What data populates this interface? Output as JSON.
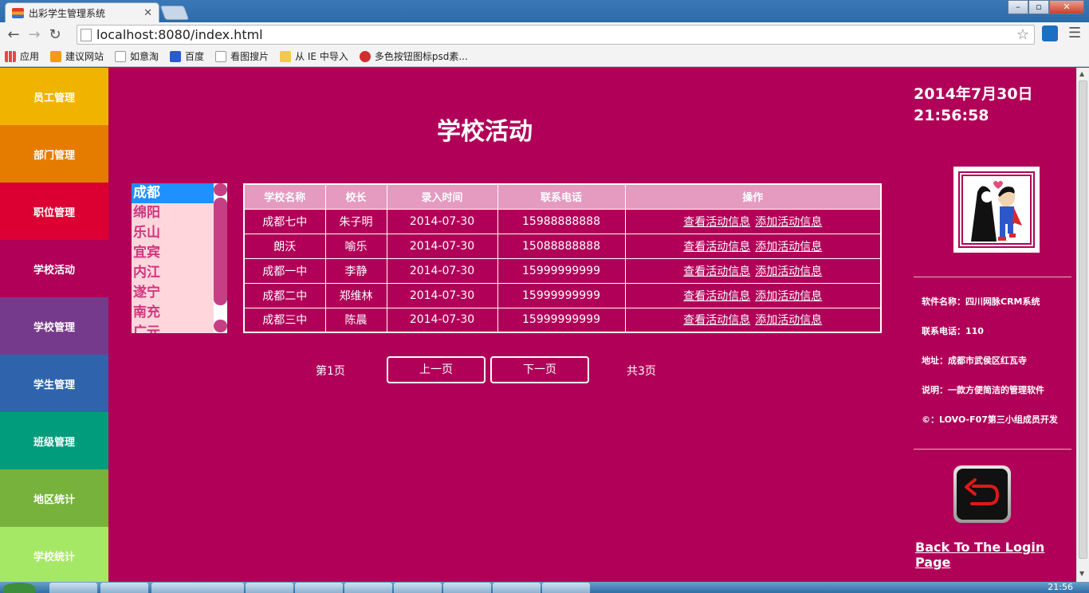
{
  "browser": {
    "tab_title": "出彩学生管理系统",
    "url": "localhost:8080/index.html",
    "bookmarks": [
      "应用",
      "建议网站",
      "如意淘",
      "百度",
      "看图搜片",
      "从 IE 中导入",
      "多色按钮图标psd素..."
    ]
  },
  "sidebar": {
    "items": [
      {
        "label": "员工管理",
        "color": "#f0b400"
      },
      {
        "label": "部门管理",
        "color": "#e57c00"
      },
      {
        "label": "职位管理",
        "color": "#dc0032"
      },
      {
        "label": "学校活动",
        "color": "#b10058"
      },
      {
        "label": "学校管理",
        "color": "#763a8c"
      },
      {
        "label": "学生管理",
        "color": "#2f64ac"
      },
      {
        "label": "班级管理",
        "color": "#009c7c"
      },
      {
        "label": "地区统计",
        "color": "#77b33c"
      },
      {
        "label": "学校统计",
        "color": "#a5e866"
      }
    ]
  },
  "main": {
    "title": "学校活动",
    "cities": [
      "成都",
      "绵阳",
      "乐山",
      "宜宾",
      "内江",
      "遂宁",
      "南充",
      "广元"
    ],
    "table": {
      "headers": [
        "学校名称",
        "校长",
        "录入时间",
        "联系电话",
        "操作"
      ],
      "rows": [
        {
          "name": "成都七中",
          "principal": "朱子明",
          "date": "2014-07-30",
          "phone": "15988888888"
        },
        {
          "name": "朗沃",
          "principal": "喻乐",
          "date": "2014-07-30",
          "phone": "15088888888"
        },
        {
          "name": "成都一中",
          "principal": "李静",
          "date": "2014-07-30",
          "phone": "15999999999"
        },
        {
          "name": "成都二中",
          "principal": "郑维林",
          "date": "2014-07-30",
          "phone": "15999999999"
        },
        {
          "name": "成都三中",
          "principal": "陈晨",
          "date": "2014-07-30",
          "phone": "15999999999"
        }
      ],
      "action_view": "查看活动信息",
      "action_add": "添加活动信息"
    },
    "pager": {
      "current": "第1页",
      "prev": "上一页",
      "next": "下一页",
      "total": "共3页"
    }
  },
  "right": {
    "date": "2014年7月30日",
    "time": "21:56:58",
    "info": [
      "软件名称：四川网脉CRM系统",
      "联系电话：110",
      "地址：成都市武侯区红瓦寺",
      "说明：一款方便简洁的管理软件",
      "©：LOVO-F07第三小组成员开发"
    ],
    "back_link": "Back To The Login Page"
  },
  "taskbar": {
    "clock": "21:56"
  },
  "colors": {
    "page_bg": "#b10058",
    "header_row": "#e59ac0",
    "city_list_bg": "#ffd6dc",
    "city_selected": "#1e90ff"
  }
}
